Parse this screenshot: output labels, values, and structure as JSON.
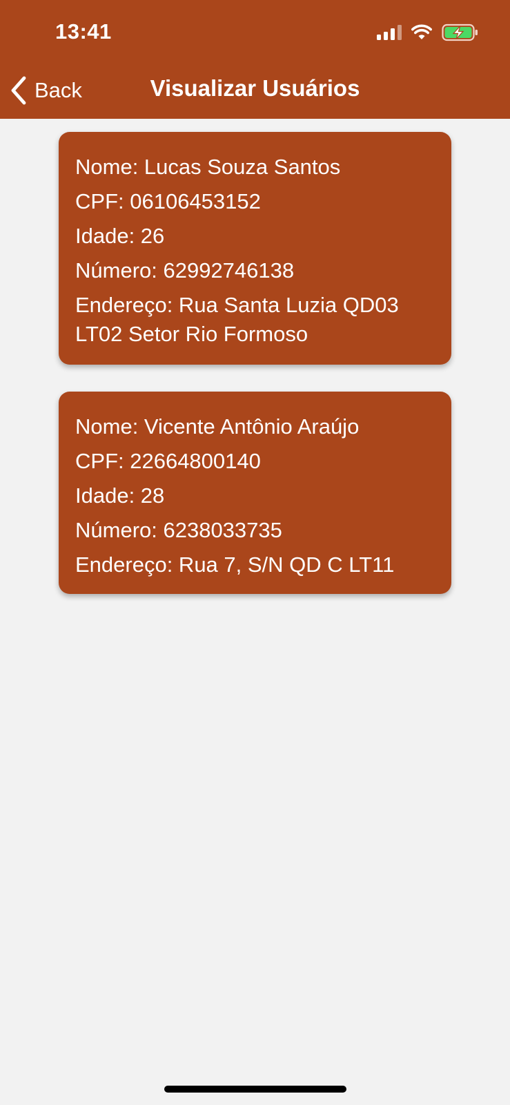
{
  "status_bar": {
    "time": "13:41",
    "icons": [
      "signal-icon",
      "wifi-icon",
      "battery-charging-icon"
    ],
    "battery_color": "#4cd964"
  },
  "nav": {
    "back_label": "Back",
    "title": "Visualizar Usuários"
  },
  "colors": {
    "primary": "#aa461b",
    "background": "#f2f2f2",
    "text_on_primary": "#ffffff"
  },
  "users": [
    {
      "nome": "Nome: Lucas Souza Santos",
      "cpf": "CPF: 06106453152",
      "idade": "Idade: 26",
      "numero": "Número: 62992746138",
      "endereco": "Endereço: Rua Santa Luzia QD03 LT02 Setor Rio Formoso"
    },
    {
      "nome": "Nome: Vicente Antônio Araújo",
      "cpf": "CPF: 22664800140",
      "idade": "Idade: 28",
      "numero": "Número: 6238033735",
      "endereco": "Endereço: Rua 7, S/N QD C LT11"
    }
  ]
}
